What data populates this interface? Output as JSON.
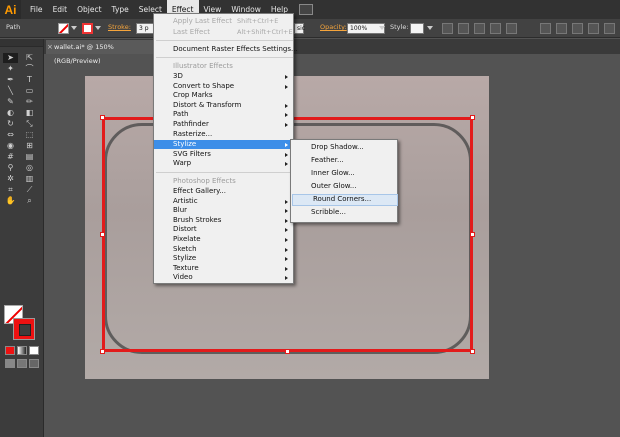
{
  "app": {
    "logo": "Ai"
  },
  "menubar": {
    "items": [
      "File",
      "Edit",
      "Object",
      "Type",
      "Select",
      "Effect",
      "View",
      "Window",
      "Help"
    ],
    "active": "Effect"
  },
  "controlbar": {
    "selection_label": "Path",
    "stroke_label": "Stroke:",
    "stroke_weight": "3 p",
    "brush_suffix": "sic",
    "opacity_label": "Opacity:",
    "opacity_value": "100%",
    "style_label": "Style:"
  },
  "document_tab": {
    "title": "wallet.ai* @ 150% (RGB/Preview)",
    "close_glyph": "×"
  },
  "effect_menu": {
    "apply_last_effect": {
      "label": "Apply Last Effect",
      "shortcut": "Shift+Ctrl+E"
    },
    "last_effect": {
      "label": "Last Effect",
      "shortcut": "Alt+Shift+Ctrl+E"
    },
    "document_raster_settings": "Document Raster Effects Settings...",
    "illustrator_effects_header": "Illustrator Effects",
    "illustrator_effects": [
      "3D",
      "Convert to Shape",
      "Crop Marks",
      "Distort & Transform",
      "Path",
      "Pathfinder",
      "Rasterize...",
      "Stylize",
      "SVG Filters",
      "Warp"
    ],
    "photoshop_effects_header": "Photoshop Effects",
    "photoshop_effects": [
      "Effect Gallery...",
      "Artistic",
      "Blur",
      "Brush Strokes",
      "Distort",
      "Pixelate",
      "Sketch",
      "Stylize",
      "Texture",
      "Video"
    ],
    "highlighted": "Stylize"
  },
  "stylize_submenu": {
    "items": [
      "Drop Shadow...",
      "Feather...",
      "Inner Glow...",
      "Outer Glow...",
      "Round Corners...",
      "Scribble..."
    ],
    "hovered": "Round Corners..."
  },
  "tools": [
    {
      "icon": "selection-tool-icon",
      "glyph": "➤"
    },
    {
      "icon": "direct-selection-tool-icon",
      "glyph": "⇱"
    },
    {
      "icon": "magic-wand-tool-icon",
      "glyph": "✦"
    },
    {
      "icon": "lasso-tool-icon",
      "glyph": "⌒"
    },
    {
      "icon": "pen-tool-icon",
      "glyph": "✒"
    },
    {
      "icon": "type-tool-icon",
      "glyph": "T"
    },
    {
      "icon": "line-tool-icon",
      "glyph": "╲"
    },
    {
      "icon": "rectangle-tool-icon",
      "glyph": "▭"
    },
    {
      "icon": "paintbrush-tool-icon",
      "glyph": "✎"
    },
    {
      "icon": "pencil-tool-icon",
      "glyph": "✏"
    },
    {
      "icon": "blob-brush-tool-icon",
      "glyph": "◐"
    },
    {
      "icon": "eraser-tool-icon",
      "glyph": "◧"
    },
    {
      "icon": "rotate-tool-icon",
      "glyph": "↻"
    },
    {
      "icon": "scale-tool-icon",
      "glyph": "⤡"
    },
    {
      "icon": "width-tool-icon",
      "glyph": "⇔"
    },
    {
      "icon": "free-transform-tool-icon",
      "glyph": "⬚"
    },
    {
      "icon": "shape-builder-tool-icon",
      "glyph": "◉"
    },
    {
      "icon": "perspective-grid-tool-icon",
      "glyph": "⊞"
    },
    {
      "icon": "mesh-tool-icon",
      "glyph": "#"
    },
    {
      "icon": "gradient-tool-icon",
      "glyph": "▤"
    },
    {
      "icon": "eyedropper-tool-icon",
      "glyph": "⚲"
    },
    {
      "icon": "blend-tool-icon",
      "glyph": "◎"
    },
    {
      "icon": "symbol-sprayer-tool-icon",
      "glyph": "✲"
    },
    {
      "icon": "column-graph-tool-icon",
      "glyph": "▥"
    },
    {
      "icon": "artboard-tool-icon",
      "glyph": "⌗"
    },
    {
      "icon": "slice-tool-icon",
      "glyph": "⟋"
    },
    {
      "icon": "hand-tool-icon",
      "glyph": "✋"
    },
    {
      "icon": "zoom-tool-icon",
      "glyph": "⌕"
    }
  ],
  "colors": {
    "menu_highlight": "#3d8ee8",
    "selection_stroke": "#e21b1b",
    "logo_orange": "#ff9a00"
  }
}
